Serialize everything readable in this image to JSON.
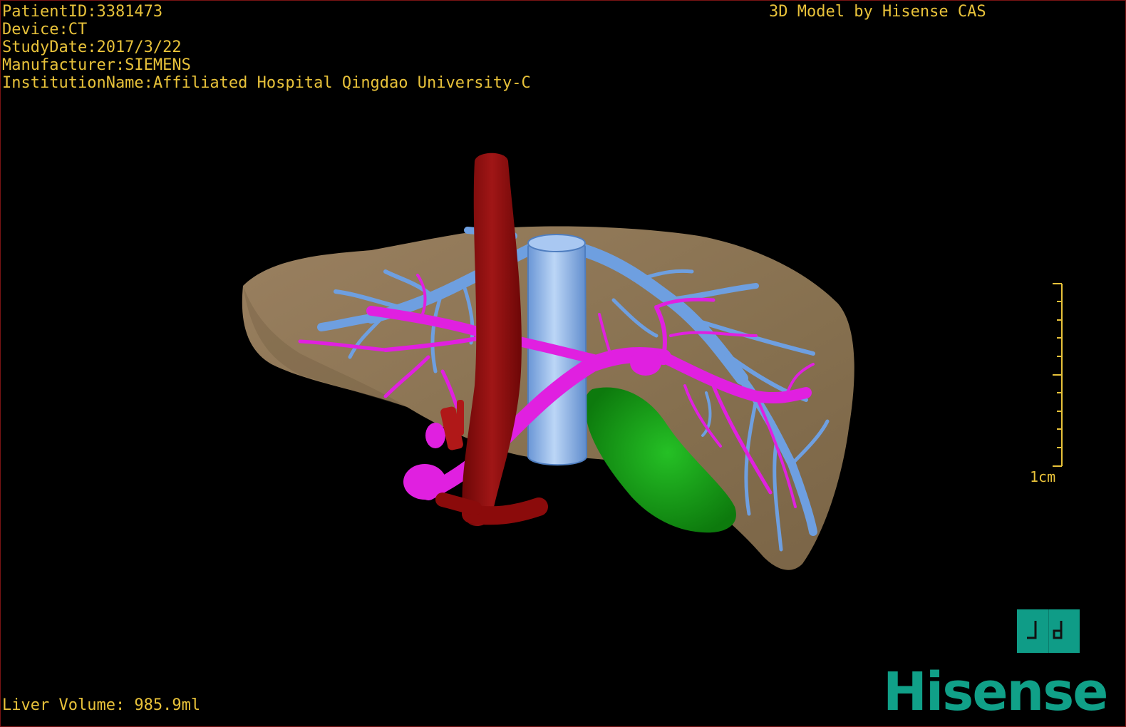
{
  "info": {
    "patient_id": "PatientID:3381473",
    "device": "Device:CT",
    "study_date": "StudyDate:2017/3/22",
    "manufacturer": "Manufacturer:SIEMENS",
    "institution": "InstitutionName:Affiliated Hospital Qingdao University-C"
  },
  "credit": "3D Model by Hisense CAS",
  "liver_volume": "Liver Volume: 985.9ml",
  "scale": {
    "label": "1cm"
  },
  "logo": {
    "text": "Hisense",
    "badge_icon": "hisense-badge-icon"
  },
  "colors": {
    "overlay_text": "#e8c23a",
    "liver": "#8c7453",
    "hepatic_vein": "#6e9fe0",
    "portal_vein": "#e020e0",
    "artery_aorta": "#8b0b0b",
    "gallbladder": "#129a12",
    "brand": "#10a088",
    "border": "#7a1414"
  }
}
